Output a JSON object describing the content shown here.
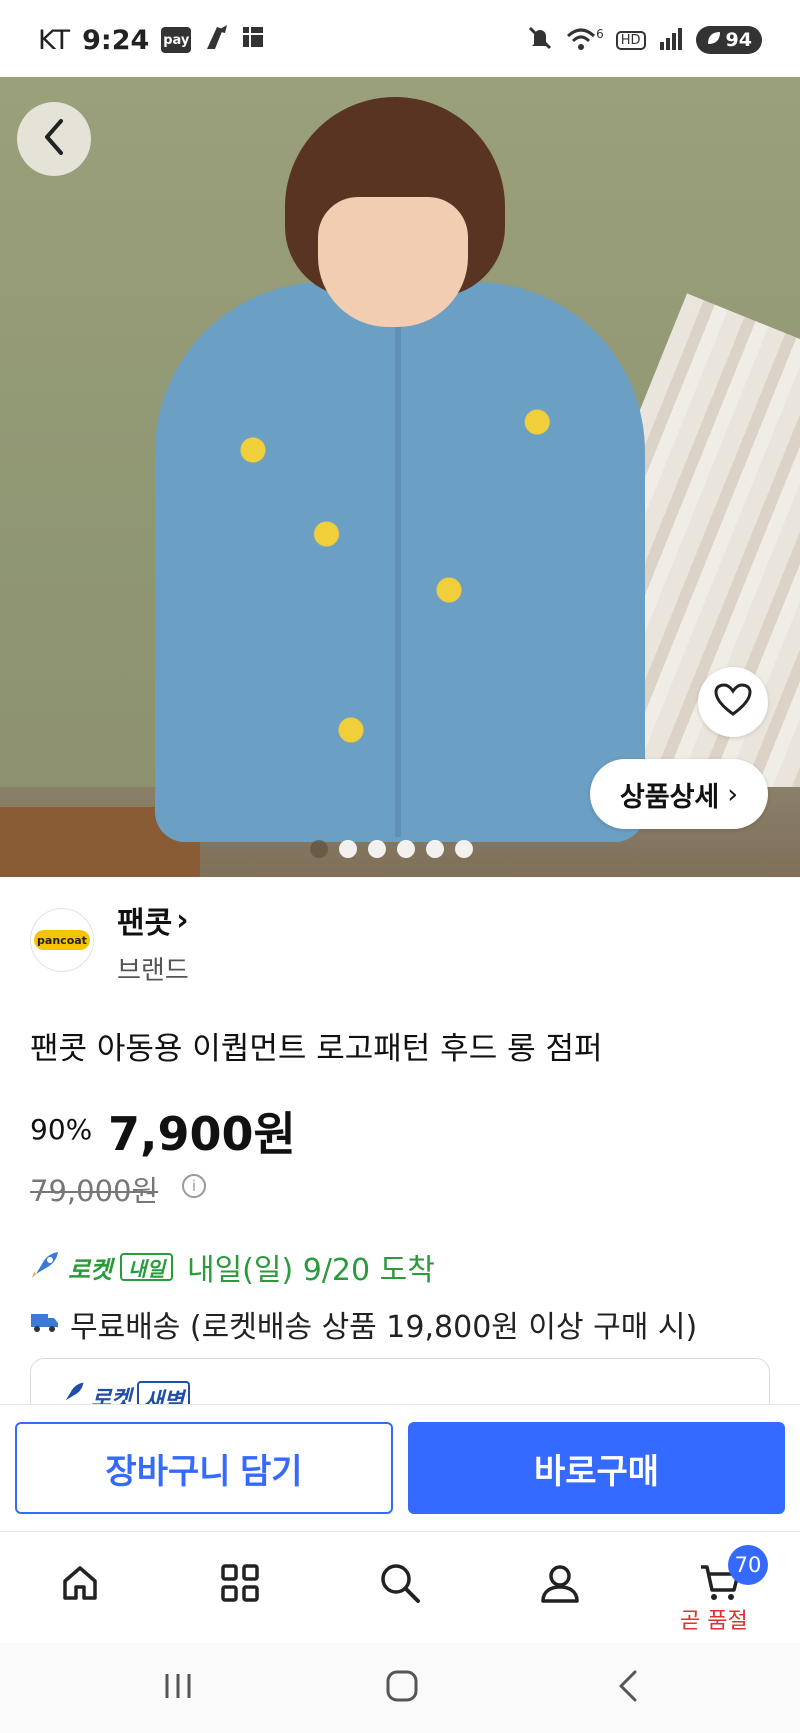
{
  "status_bar": {
    "carrier": "KT",
    "time": "9:24",
    "pay_badge": "pay",
    "network": "6",
    "hd": "HD",
    "battery": "94"
  },
  "hero": {
    "back_icon": "chevron-left-icon",
    "heart_icon": "heart-outline-icon",
    "detail_button": "상품상세",
    "detail_chevron": "›",
    "image_count": 6,
    "active_index": 0
  },
  "brand": {
    "logo_text": "pancoat",
    "name": "팬콧",
    "name_chevron": "›",
    "sub": "브랜드"
  },
  "product": {
    "title": "팬콧 아동용 이퀍먼트 로고패턴 후드 롱 점퍼",
    "discount": "90%",
    "price": "7,900원",
    "original_price": "79,000원",
    "info_icon": "i"
  },
  "delivery": {
    "rocket_label": "로켓",
    "naeil_badge": "내일",
    "date": "내일(일) 9/20 도착",
    "shipping": "무료배송 (로켓배송 상품 19,800원 이상 구매 시)",
    "peek_rocket": "로켓",
    "peek_badge": "새벽"
  },
  "actions": {
    "cart": "장바구니 담기",
    "buy": "바로구매"
  },
  "bottom_nav": {
    "cart_badge": "70",
    "soldout_label": "곧 품절"
  },
  "colors": {
    "accent": "#346aff",
    "rocket_green": "#2a9a3a",
    "soldout_red": "#e03030"
  }
}
